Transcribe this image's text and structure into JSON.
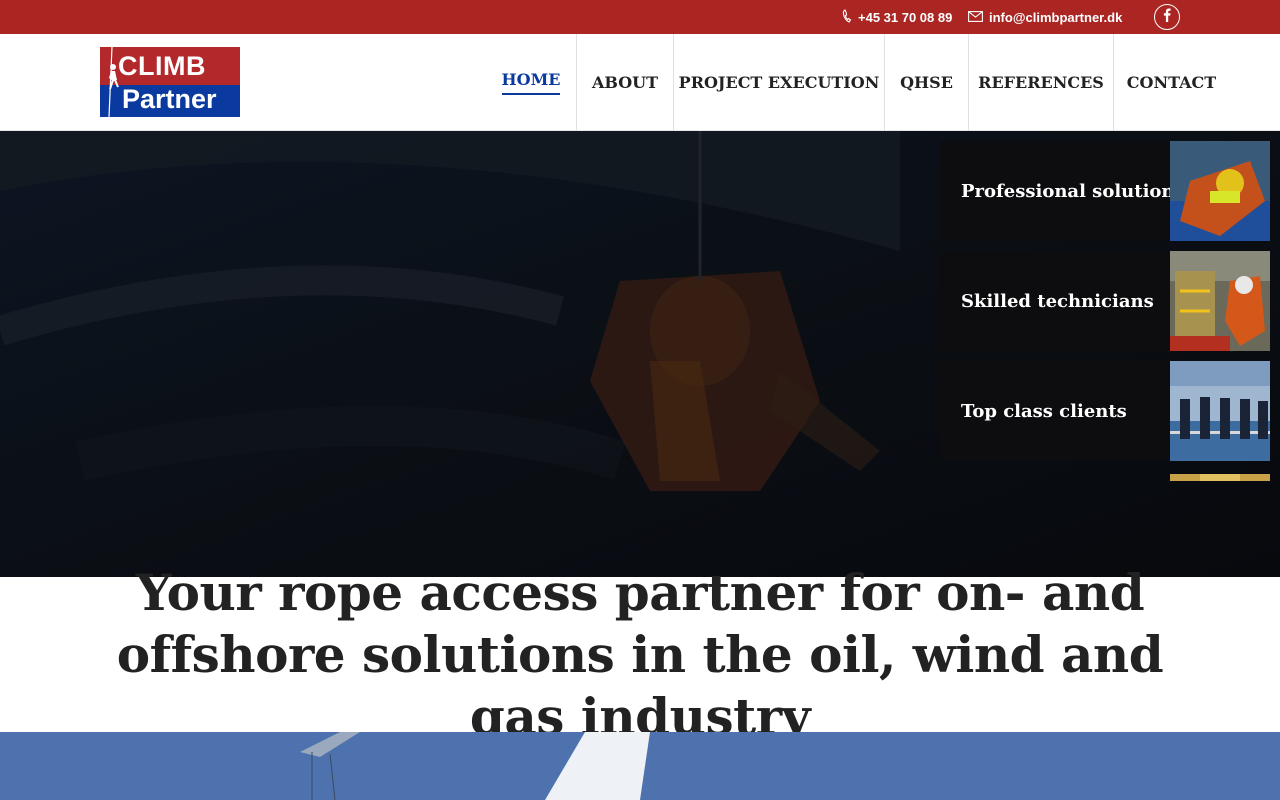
{
  "topbar": {
    "phone": "+45 31 70 08 89",
    "email": "info@climbpartner.dk",
    "phone_icon": "phone-icon",
    "email_icon": "envelope-icon",
    "social_icon": "facebook-icon",
    "color": "#ab2623"
  },
  "logo": {
    "line1": "CLIMB",
    "line2": "Partner",
    "red": "#b3282a",
    "blue": "#0a3aa0"
  },
  "nav": {
    "items": [
      {
        "label": "HOME",
        "active": true
      },
      {
        "label": "ABOUT"
      },
      {
        "label": "PROJECT EXECUTION"
      },
      {
        "label": "QHSE"
      },
      {
        "label": "REFERENCES"
      },
      {
        "label": "CONTACT"
      }
    ],
    "active_color": "#0a3aa0"
  },
  "hero": {
    "cards": [
      {
        "label": "Professional solutions"
      },
      {
        "label": "Skilled technicians"
      },
      {
        "label": "Top class clients"
      }
    ]
  },
  "headline": {
    "text": "Your rope access partner for on- and offshore solutions in the oil, wind and gas industry"
  }
}
